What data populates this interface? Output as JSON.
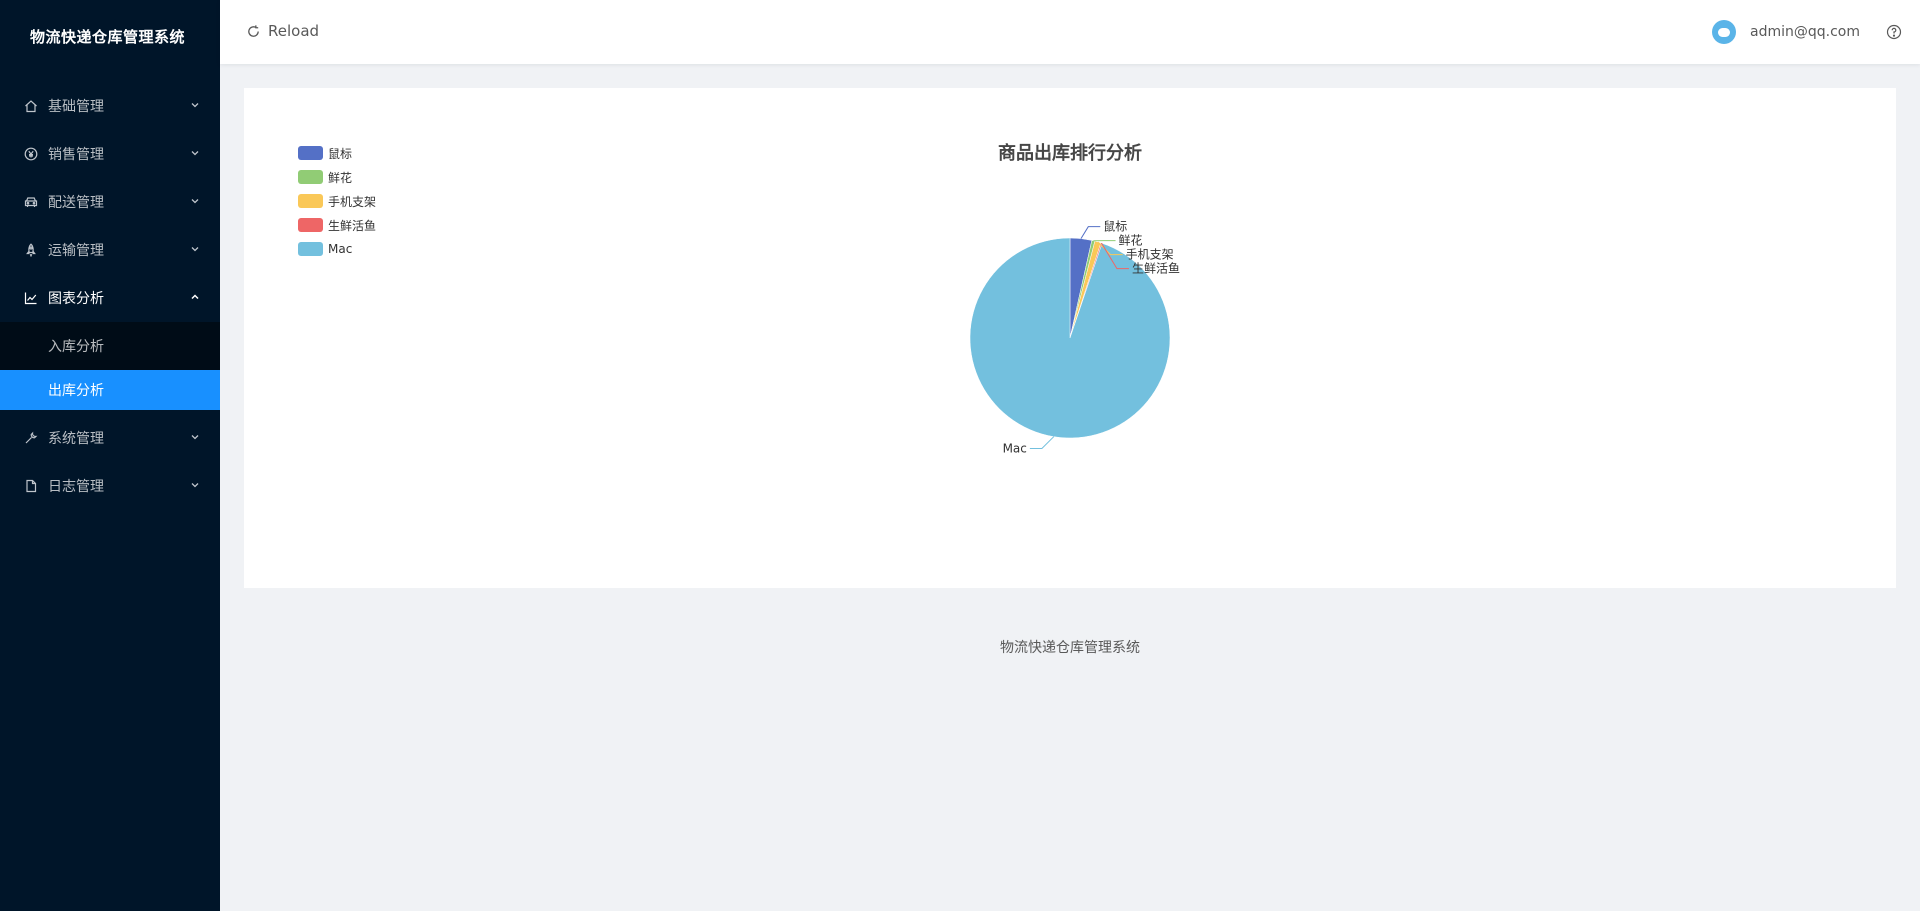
{
  "sidebar": {
    "app_title": "物流快递仓库管理系统",
    "menus": [
      {
        "label": "基础管理",
        "icon": "home-icon"
      },
      {
        "label": "销售管理",
        "icon": "currency-circle-icon"
      },
      {
        "label": "配送管理",
        "icon": "car-icon"
      },
      {
        "label": "运输管理",
        "icon": "rocket-icon"
      },
      {
        "label": "图表分析",
        "icon": "line-chart-icon",
        "open": true,
        "children": [
          "入库分析",
          "出库分析"
        ],
        "active_child": "出库分析"
      },
      {
        "label": "系统管理",
        "icon": "tool-icon"
      },
      {
        "label": "日志管理",
        "icon": "file-icon"
      }
    ]
  },
  "header": {
    "reload_label": "Reload",
    "user_email": "admin@qq.com"
  },
  "footer": {
    "text": "物流快递仓库管理系统"
  },
  "colors": {
    "sidebar_bg": "#001529",
    "submenu_bg": "#000c17",
    "active": "#1890ff"
  },
  "chart_data": {
    "type": "pie",
    "title": "商品出库排行分析",
    "legend_position": "top-left",
    "slices": [
      {
        "name": "鼠标",
        "value": 3.5,
        "color": "#5470c6"
      },
      {
        "name": "鲜花",
        "value": 0.5,
        "color": "#91cc75"
      },
      {
        "name": "手机支架",
        "value": 1,
        "color": "#fac858"
      },
      {
        "name": "生鲜活鱼",
        "value": 0.2,
        "color": "#ee6666"
      },
      {
        "name": "Mac",
        "value": 94.8,
        "color": "#73c0de"
      }
    ]
  }
}
